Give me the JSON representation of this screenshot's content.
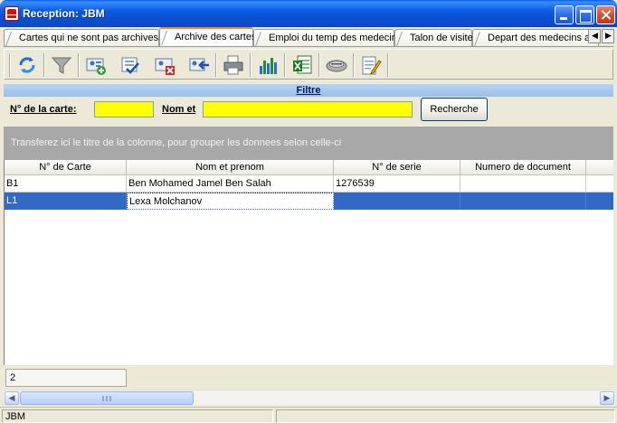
{
  "window": {
    "title": "Reception: JBM"
  },
  "tabs": [
    {
      "label": "Cartes qui ne sont pas archives",
      "active": false
    },
    {
      "label": "Archive des cartes",
      "active": true
    },
    {
      "label": "Emploi du temp des medecins",
      "active": false
    },
    {
      "label": "Talon de visite",
      "active": false
    },
    {
      "label": "Depart des medecins a la",
      "active": false
    }
  ],
  "toolbar": {
    "icons": [
      "refresh-icon",
      "filter-funnel-icon",
      "add-card-icon",
      "check-card-icon",
      "delete-card-icon",
      "import-card-icon",
      "print-icon",
      "bar-chart-icon",
      "excel-export-icon",
      "scanner-icon",
      "edit-notes-icon"
    ]
  },
  "filter": {
    "header": "Filtre",
    "card_label": "N° de la carte:",
    "card_value": "",
    "name_label": "Nom et",
    "name_value": "",
    "search_button": "Recherche"
  },
  "group_panel": {
    "hint": "Transferez ici le titre de la colonne, pour grouper les donnees selon celle-ci"
  },
  "grid": {
    "columns": [
      "N° de Carte",
      "Nom et prenom",
      "N° de serie",
      "Numero de document",
      "D"
    ],
    "rows": [
      {
        "cells": [
          "B1",
          "Ben Mohamed Jamel Ben Salah",
          "1276539",
          "",
          ""
        ],
        "selected": false
      },
      {
        "cells": [
          "L1",
          "Lexa Molchanov",
          "",
          "",
          ""
        ],
        "selected": true
      }
    ]
  },
  "footer": {
    "count": "2"
  },
  "statusbar": {
    "left": "JBM",
    "right": ""
  },
  "colors": {
    "titlebar": "#0a4fd0",
    "filter_input": "#ffff00",
    "selection": "#316ac5",
    "group_panel": "#a8a8a8"
  }
}
